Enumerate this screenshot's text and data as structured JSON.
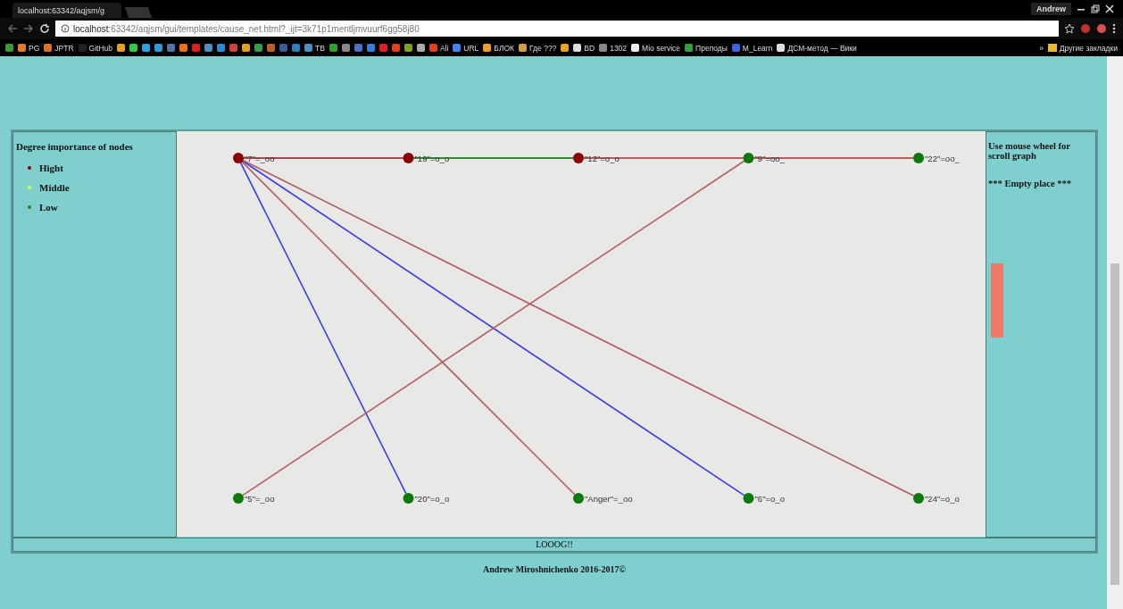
{
  "browser": {
    "tab_title": "localhost:63342/aqjsm/g",
    "url_host": "localhost",
    "url_rest": ":63342/aqjsm/gui/templates/cause_net.html?_ijt=3k71p1mentljmvuurf6gg58j80",
    "user": "Andrew"
  },
  "bookmarks": [
    {
      "kind": "icon",
      "color": "#3a9a3a"
    },
    {
      "kind": "link",
      "label": "PG",
      "color": "#e8772e"
    },
    {
      "kind": "link",
      "label": "JPTR",
      "color": "#e07020"
    },
    {
      "kind": "link",
      "label": "GitHub",
      "color": "#222222"
    },
    {
      "kind": "icon",
      "color": "#e8a020"
    },
    {
      "kind": "icon",
      "color": "#2ecc40"
    },
    {
      "kind": "icon",
      "color": "#2aa0e0"
    },
    {
      "kind": "icon",
      "color": "#2a9ad8"
    },
    {
      "kind": "icon",
      "color": "#4a76a8"
    },
    {
      "kind": "icon",
      "color": "#f07010"
    },
    {
      "kind": "icon",
      "color": "#e02020"
    },
    {
      "kind": "icon",
      "color": "#4a90c0"
    },
    {
      "kind": "icon",
      "color": "#2a8ad8"
    },
    {
      "kind": "icon",
      "color": "#d04040"
    },
    {
      "kind": "icon",
      "color": "#e0a020"
    },
    {
      "kind": "icon",
      "color": "#30a050"
    },
    {
      "kind": "icon",
      "color": "#c06020"
    },
    {
      "kind": "icon",
      "color": "#3b5998"
    },
    {
      "kind": "icon",
      "color": "#2a80c0"
    },
    {
      "kind": "link",
      "label": "TB",
      "color": "#4a90c0"
    },
    {
      "kind": "icon",
      "color": "#30a030"
    },
    {
      "kind": "icon",
      "color": "#888888"
    },
    {
      "kind": "icon",
      "color": "#4a70c0"
    },
    {
      "kind": "icon",
      "color": "#3080e0"
    },
    {
      "kind": "icon",
      "color": "#e02020"
    },
    {
      "kind": "icon",
      "color": "#e04020"
    },
    {
      "kind": "icon",
      "color": "#80a020"
    },
    {
      "kind": "icon",
      "color": "#aaaaaa"
    },
    {
      "kind": "link",
      "label": "Ali",
      "color": "#e04020"
    },
    {
      "kind": "link",
      "label": "URL",
      "color": "#4285f4"
    },
    {
      "kind": "link",
      "label": "БЛОК",
      "color": "#f0a020"
    },
    {
      "kind": "link",
      "label": "Где ???",
      "color": "#d0a040"
    },
    {
      "kind": "icon",
      "color": "#f0a020"
    },
    {
      "kind": "link",
      "label": "BD",
      "color": "#dddddd"
    },
    {
      "kind": "link",
      "label": "1302",
      "color": "#888888"
    },
    {
      "kind": "link",
      "label": "Mio service",
      "color": "#eeeeee"
    },
    {
      "kind": "link",
      "label": "Преподы",
      "color": "#30a040"
    },
    {
      "kind": "link",
      "label": "M_Learn",
      "color": "#4060e0"
    },
    {
      "kind": "link",
      "label": "ДСМ-метод — Вики",
      "color": "#dddddd"
    }
  ],
  "bookmarks_more": "»",
  "other_bookmarks": "Другие закладки",
  "legend": {
    "title": "Degree importance of nodes",
    "items": [
      {
        "label": "Hight",
        "color": "#8b0000"
      },
      {
        "label": "Middle",
        "color": "#ccff66"
      },
      {
        "label": "Low",
        "color": "#1e8a1e"
      }
    ]
  },
  "graph": {
    "top_nodes": [
      {
        "label": "\"7\"=_oo",
        "color": "#8b0000"
      },
      {
        "label": "\"19\"=o_o",
        "color": "#8b0000"
      },
      {
        "label": "\"12\"=o_o",
        "color": "#8b0000"
      },
      {
        "label": "\"9\"=oo_",
        "color": "#0a7a0a"
      },
      {
        "label": "\"22\"=oo_",
        "color": "#0a7a0a"
      }
    ],
    "bottom_nodes": [
      {
        "label": "\"5\"=_oo",
        "color": "#0a7a0a"
      },
      {
        "label": "\"20\"=o_o",
        "color": "#0a7a0a"
      },
      {
        "label": "\"Anger\"=_oo",
        "color": "#0a7a0a"
      },
      {
        "label": "\"6\"=o_o",
        "color": "#0a7a0a"
      },
      {
        "label": "\"24\"=o_o",
        "color": "#0a7a0a"
      }
    ],
    "edges": [
      {
        "color": "#a05050"
      },
      {
        "color": "#3a8a3a"
      },
      {
        "color": "#b06060"
      },
      {
        "color": "#b06060"
      },
      {
        "color": "#3a3aee"
      },
      {
        "color": "#b06060"
      },
      {
        "color": "#3a3aee"
      },
      {
        "color": "#b06060"
      },
      {
        "color": "#b06060"
      }
    ]
  },
  "side_panel": {
    "hint": "Use mouse wheel for scroll graph",
    "note": "*** Empty place ***"
  },
  "log": "LOOOG!!",
  "footer": "Andrew Miroshnichenko 2016-2017©"
}
